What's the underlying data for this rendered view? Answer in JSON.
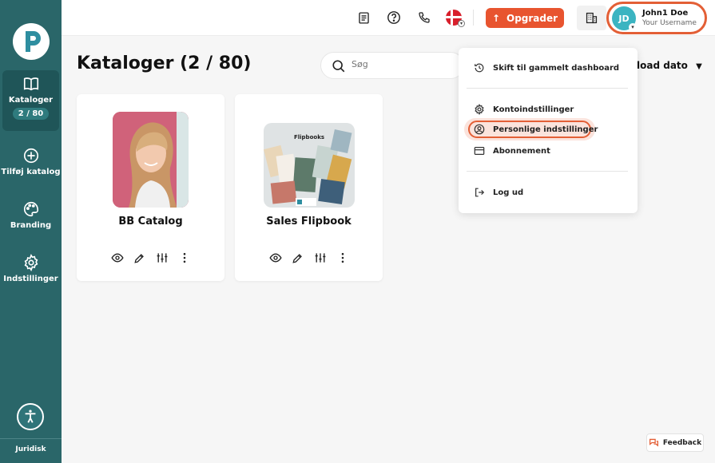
{
  "sidebar": {
    "items": [
      {
        "label": "Kataloger",
        "badge": "2 / 80",
        "icon": "book-icon"
      },
      {
        "label": "Tilføj katalog",
        "icon": "plus-circle-icon"
      },
      {
        "label": "Branding",
        "icon": "palette-icon"
      },
      {
        "label": "Indstillinger",
        "icon": "gear-icon"
      }
    ],
    "footer_label": "Juridisk"
  },
  "topbar": {
    "upgrade_label": "Opgrader",
    "user": {
      "initials": "JD",
      "name": "John1 Doe",
      "username": "Your Username"
    }
  },
  "main": {
    "title": "Kataloger (2 / 80)",
    "search_placeholder": "Søg",
    "sort_label": "load dato"
  },
  "catalogs": [
    {
      "title": "BB Catalog"
    },
    {
      "title": "Sales Flipbook",
      "cover_text": "Flipbooks"
    }
  ],
  "user_menu": {
    "items": [
      {
        "label": "Skift til gammelt dashboard",
        "icon": "history-icon"
      },
      {
        "label": "Kontoindstillinger",
        "icon": "gear-icon"
      },
      {
        "label": "Personlige indstillinger",
        "icon": "user-circle-icon",
        "highlighted": true
      },
      {
        "label": "Abonnement",
        "icon": "credit-card-icon"
      },
      {
        "label": "Log ud",
        "icon": "logout-icon"
      }
    ]
  },
  "feedback_label": "Feedback",
  "colors": {
    "sidebar": "#2a6669",
    "accent": "#e8542f",
    "avatar": "#3bb4c1"
  }
}
